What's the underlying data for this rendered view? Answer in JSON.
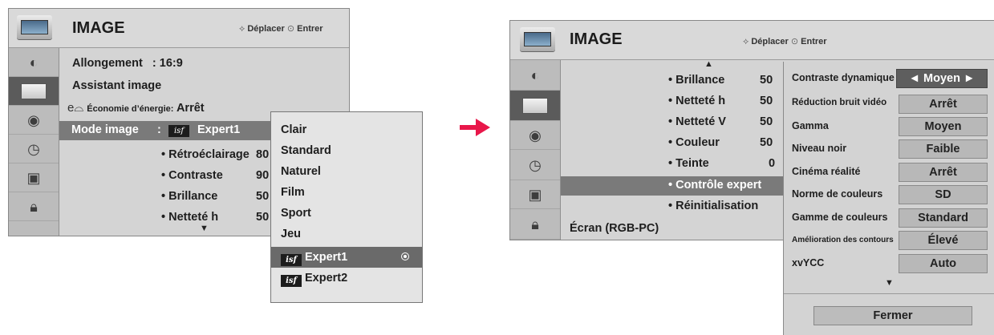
{
  "left_menu": {
    "title": "IMAGE",
    "hint_move": "Déplacer",
    "hint_enter": "Entrer",
    "rows": [
      {
        "label": "Allongement",
        "value": ": 16:9"
      },
      {
        "label": "Assistant image"
      },
      {
        "label": "Économie d’énergie:",
        "value": "Arrêt"
      }
    ],
    "mode_row": {
      "label": "Mode image",
      "colon": ":",
      "badge": "isf",
      "value": "Expert1"
    },
    "sub_items": [
      {
        "label": "• Rétroéclairage",
        "value": "80"
      },
      {
        "label": "• Contraste",
        "value": "90"
      },
      {
        "label": "• Brillance",
        "value": "50"
      },
      {
        "label": "• Netteté h",
        "value": "50"
      }
    ],
    "scroll_down": "▼"
  },
  "mode_dropdown": {
    "options": [
      {
        "label": "Clair"
      },
      {
        "label": "Standard"
      },
      {
        "label": "Naturel"
      },
      {
        "label": "Film"
      },
      {
        "label": "Sport"
      },
      {
        "label": "Jeu"
      },
      {
        "label": "Expert1",
        "badge": "isf",
        "selected": true
      },
      {
        "label": "Expert2",
        "badge": "isf"
      }
    ]
  },
  "right_menu": {
    "title": "IMAGE",
    "hint_move": "Déplacer",
    "hint_enter": "Entrer",
    "scroll_up": "▲",
    "items": [
      {
        "label": "• Brillance",
        "value": "50"
      },
      {
        "label": "• Netteté h",
        "value": "50"
      },
      {
        "label": "• Netteté V",
        "value": "50"
      },
      {
        "label": "• Couleur",
        "value": "50"
      },
      {
        "label": "• Teinte",
        "value": "0"
      },
      {
        "label": "• Contrôle expert",
        "value": ""
      },
      {
        "label": "• Réinitialisation",
        "value": ""
      }
    ],
    "screen_item": "Écran (RGB-PC)"
  },
  "expert_panel": {
    "settings": [
      {
        "label": "Contraste dynamique",
        "value": "Moyen",
        "left_arrow": "◄",
        "right_arrow": "►"
      },
      {
        "label": "Réduction bruit vidéo",
        "value": "Arrêt"
      },
      {
        "label": "Gamma",
        "value": "Moyen"
      },
      {
        "label": "Niveau noir",
        "value": "Faible"
      },
      {
        "label": "Cinéma réalité",
        "value": "Arrêt"
      },
      {
        "label": "Norme de couleurs",
        "value": "SD"
      },
      {
        "label": "Gamme de couleurs",
        "value": "Standard"
      },
      {
        "label": "Amélioration des contours",
        "value": "Élevé"
      },
      {
        "label": "xvYCC",
        "value": "Auto"
      }
    ],
    "scroll_down": "▼",
    "close_label": "Fermer"
  },
  "colors": {
    "arrow": "#e8174a",
    "highlight": "#7a7a7a",
    "selected_value": "#5e5e5e"
  }
}
